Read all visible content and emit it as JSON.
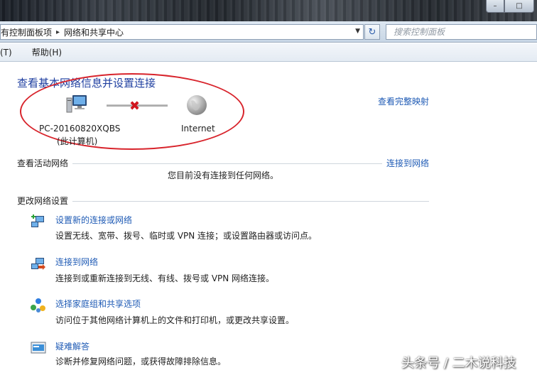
{
  "window": {
    "minimize": "–",
    "maximize": "□"
  },
  "address": {
    "crumb1": "有控制面板项",
    "crumb2": "网络和共享中心",
    "search_placeholder": "搜索控制面板"
  },
  "menu": {
    "item1": "(T)",
    "item2": "帮助(H)"
  },
  "main": {
    "title": "查看基本网络信息并设置连接",
    "full_map": "查看完整映射",
    "computer_name": "PC-20160820XQBS",
    "computer_sub": "(此计算机)",
    "internet": "Internet"
  },
  "active": {
    "heading": "查看活动网络",
    "connect_link": "连接到网络",
    "no_connection": "您目前没有连接到任何网络。"
  },
  "change": {
    "heading": "更改网络设置",
    "tasks": [
      {
        "link": "设置新的连接或网络",
        "desc": "设置无线、宽带、拨号、临时或 VPN 连接；或设置路由器或访问点。"
      },
      {
        "link": "连接到网络",
        "desc": "连接到或重新连接到无线、有线、拨号或 VPN 网络连接。"
      },
      {
        "link": "选择家庭组和共享选项",
        "desc": "访问位于其他网络计算机上的文件和打印机，或更改共享设置。"
      },
      {
        "link": "疑难解答",
        "desc": "诊断并修复网络问题，或获得故障排除信息。"
      }
    ]
  },
  "watermark": "头条号 / 二木说科技",
  "colors": {
    "link": "#1f5bb5",
    "title": "#1f3fa0",
    "annotation": "#d8242c"
  }
}
